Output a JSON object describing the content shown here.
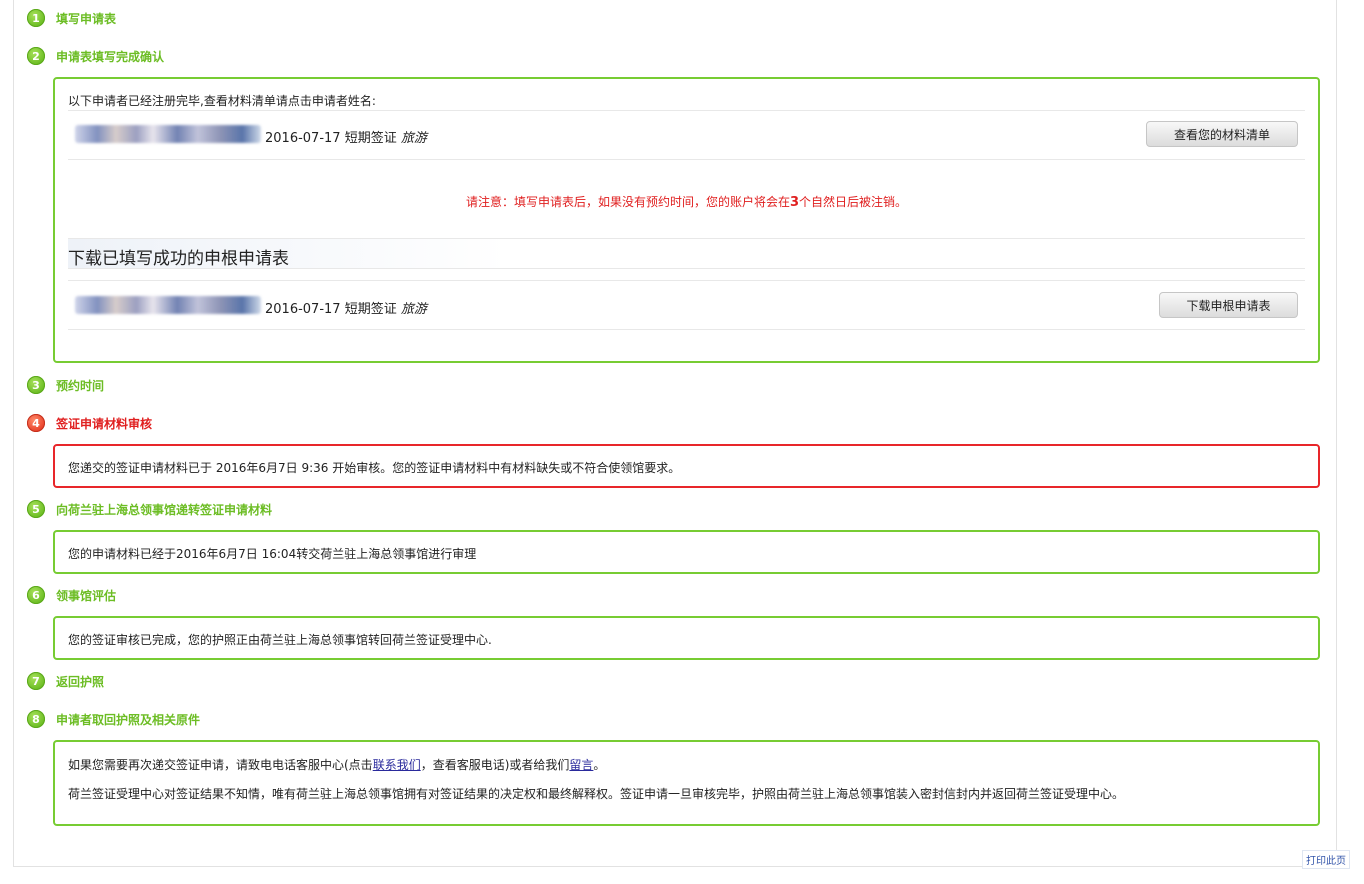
{
  "steps": [
    {
      "num": "1",
      "title": "填写申请表"
    },
    {
      "num": "2",
      "title": "申请表填写完成确认"
    },
    {
      "num": "3",
      "title": "预约时间"
    },
    {
      "num": "4",
      "title": "签证申请材料审核"
    },
    {
      "num": "5",
      "title": "向荷兰驻上海总领事馆递转签证申请材料"
    },
    {
      "num": "6",
      "title": "领事馆评估"
    },
    {
      "num": "7",
      "title": "返回护照"
    },
    {
      "num": "8",
      "title": "申请者取回护照及相关原件"
    }
  ],
  "confirm": {
    "intro": "以下申请者已经注册完毕,查看材料清单请点击申请者姓名:",
    "record1": {
      "date": "2016-07-17",
      "type": "短期签证",
      "purpose": "旅游"
    },
    "button1": "查看您的材料清单",
    "notice_prefix": "请注意：填写申请表后，如果没有预约时间，您的账户将会在",
    "notice_days": "3",
    "notice_suffix": "个自然日后被注销。",
    "download_heading": "下载已填写成功的申根申请表",
    "record2": {
      "date": "2016-07-17",
      "type": "短期签证",
      "purpose": "旅游"
    },
    "button2": "下载申根申请表"
  },
  "review_msg": "您递交的签证申请材料已于 2016年6月7日 9:36 开始审核。您的签证申请材料中有材料缺失或不符合使领馆要求。",
  "forward_msg": "您的申请材料已经于2016年6月7日 16:04转交荷兰驻上海总领事馆进行审理",
  "consulate_msg": "您的签证审核已完成，您的护照正由荷兰驻上海总领事馆转回荷兰签证受理中心.",
  "final": {
    "p1_a": "如果您需要再次递交签证申请，请致电电话客服中心(点击",
    "p1_link1": "联系我们",
    "p1_b": "，查看客服电话)或者给我们",
    "p1_link2": "留言",
    "p1_c": "。",
    "p2": "荷兰签证受理中心对签证结果不知情，唯有荷兰驻上海总领事馆拥有对签证结果的决定权和最终解释权。签证申请一旦审核完毕，护照由荷兰驻上海总领事馆装入密封信封内并返回荷兰签证受理中心。"
  },
  "print_label": "打印此页",
  "colors": {
    "step_green": "#6cbd24",
    "box_green": "#77cc33",
    "alert_red": "#e8262a"
  }
}
